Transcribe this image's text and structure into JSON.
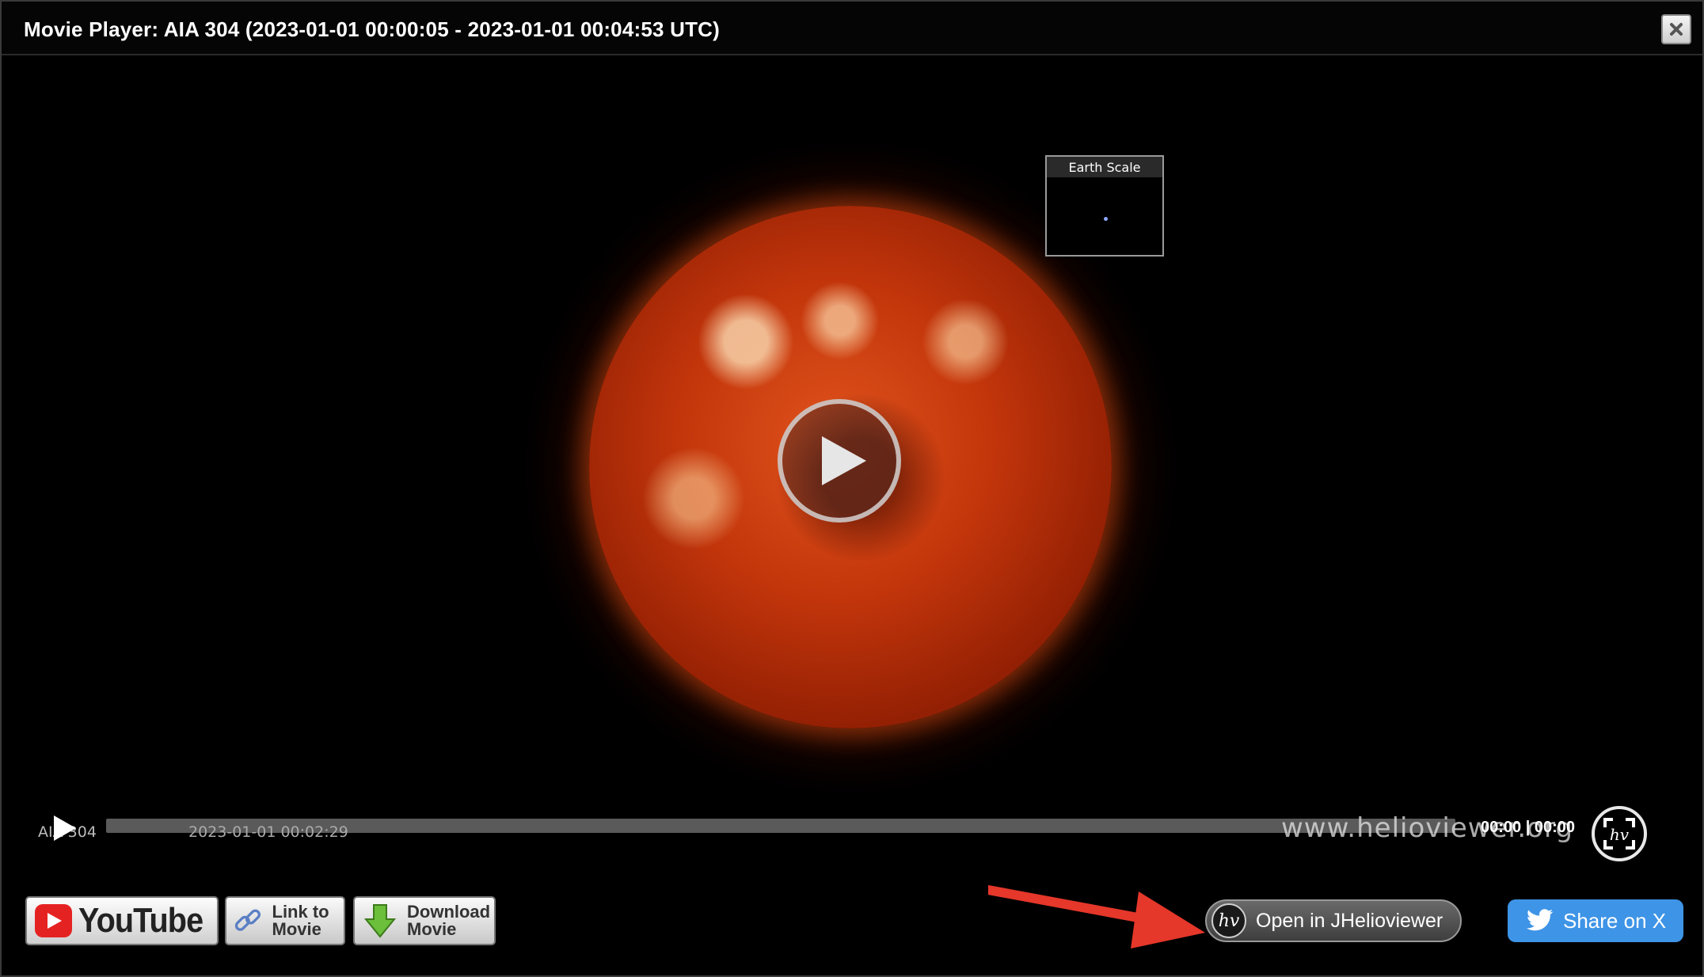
{
  "window": {
    "title": "Movie Player: AIA 304 (2023-01-01 00:00:05 - 2023-01-01 00:04:53 UTC)"
  },
  "overlay": {
    "earth_scale_label": "Earth Scale"
  },
  "controls": {
    "layer_label": "AIA 304",
    "frame_time": "2023-01-01 00:02:29",
    "watermark": "www.helioviewer.org",
    "time_readout": "00:00 | 00:00",
    "progress": 0.0
  },
  "actions": {
    "youtube_label": "YouTube",
    "link_label": "Link to Movie",
    "download_label": "Download Movie",
    "jhv_logo": "hv",
    "jhv_label": "Open in JHelioviewer",
    "share_label": "Share on X"
  },
  "colors": {
    "accent_arrow": "#e5372a",
    "share_blue": "#3e94e6",
    "youtube_red": "#e52222"
  }
}
